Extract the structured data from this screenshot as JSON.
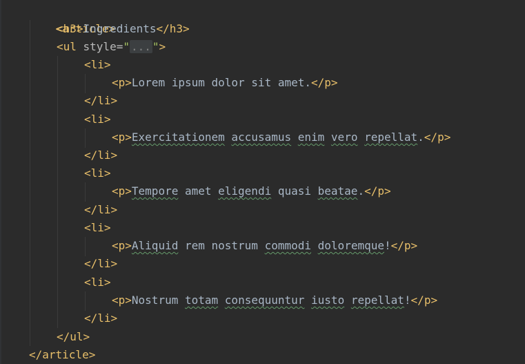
{
  "code": {
    "article_open": "<article>",
    "h3_open": "<h3>",
    "h3_text": "Ingredients",
    "h3_close": "</h3>",
    "ul_open_start": "<ul ",
    "ul_attr": "style=",
    "ul_quote_open": "\"",
    "ul_folded": "...",
    "ul_quote_close": "\"",
    "ul_open_end": ">",
    "li_open": "<li>",
    "li_close": "</li>",
    "p_open": "<p>",
    "p_close": "</p>",
    "ul_close": "</ul>",
    "article_close": "</article>",
    "item1": {
      "w1": "Lorem ipsum dolor sit amet."
    },
    "item2": {
      "w1": "Exercitationem",
      "s1": " ",
      "w2": "accusamus",
      "s2": " ",
      "w3": "enim",
      "s3": " ",
      "w4": "vero",
      "s4": " ",
      "w5": "repellat",
      "end": "."
    },
    "item3": {
      "w1": "Tempore",
      "s1": " amet ",
      "w2": "eligendi",
      "s2": " quasi ",
      "w3": "beatae",
      "end": "."
    },
    "item4": {
      "w1": "Aliquid",
      "s1": " rem nostrum ",
      "w2": "commodi",
      "s2": " ",
      "w3": "doloremque",
      "end": "!"
    },
    "item5": {
      "w1": "Nostrum",
      "s1": " ",
      "w2": "totam",
      "s2": " ",
      "w3": "consequuntur",
      "s3": " ",
      "w4": "iusto",
      "s4": " ",
      "w5": "repellat",
      "end": "!"
    }
  },
  "colors": {
    "background": "#2b2b2b",
    "tag": "#e8bf6a",
    "attribute": "#bababa",
    "string": "#a5c261",
    "text": "#a9b7c6",
    "typo_underline": "#659c6b"
  }
}
